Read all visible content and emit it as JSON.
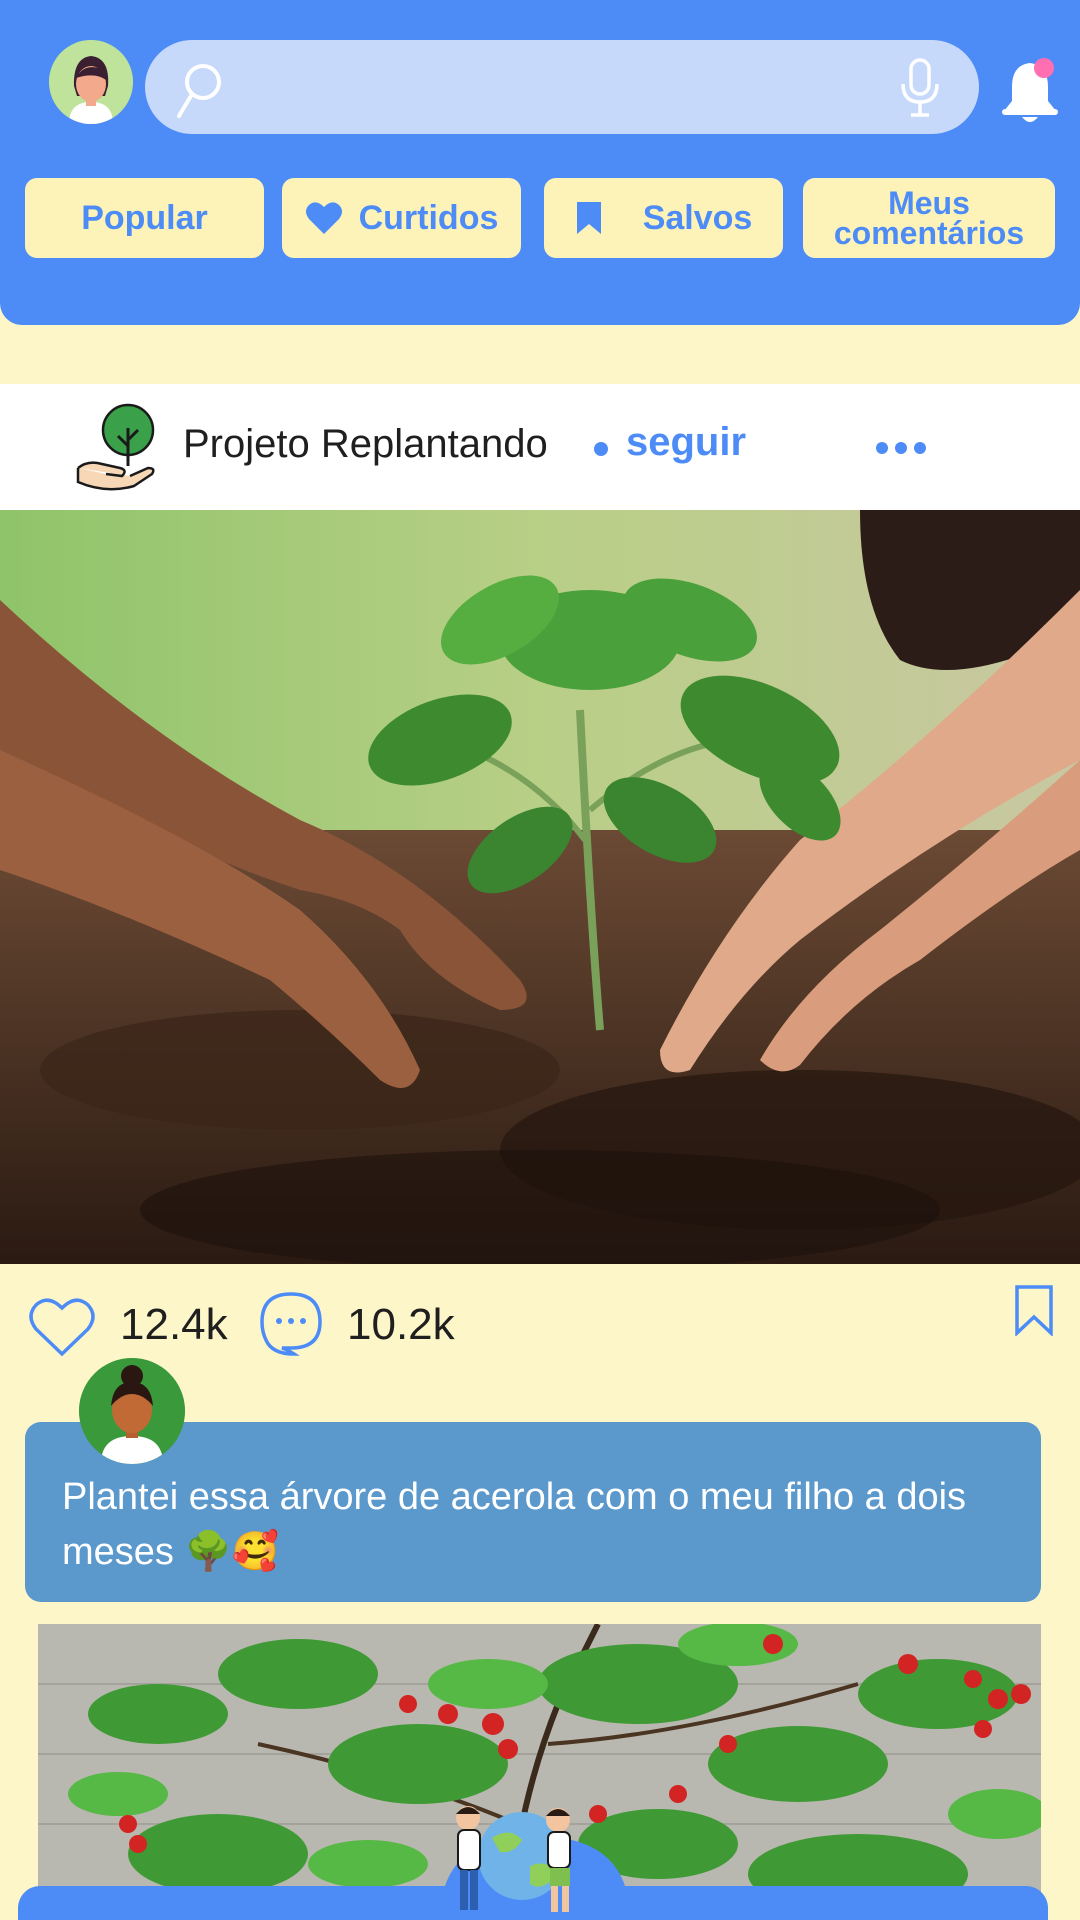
{
  "header": {
    "search_placeholder": "",
    "filters": [
      {
        "label": "Popular",
        "icon": ""
      },
      {
        "label": "Curtidos",
        "icon": "heart-icon"
      },
      {
        "label": "Salvos",
        "icon": "bookmark-icon"
      },
      {
        "label": "Meus comentários",
        "icon": ""
      }
    ],
    "notification_badge": true
  },
  "post": {
    "author": "Projeto Replantando",
    "follow_label": "seguir",
    "likes": "12.4k",
    "comments": "10.2k"
  },
  "comment": {
    "text": "Plantei essa árvore de acerola com o meu filho a dois meses 🌳🥰"
  },
  "colors": {
    "primary": "#4d8cf6",
    "background": "#fdf6c9",
    "pill": "#fdf3b8",
    "comment_card": "#5b98cc",
    "badge": "#ff6fb1"
  }
}
